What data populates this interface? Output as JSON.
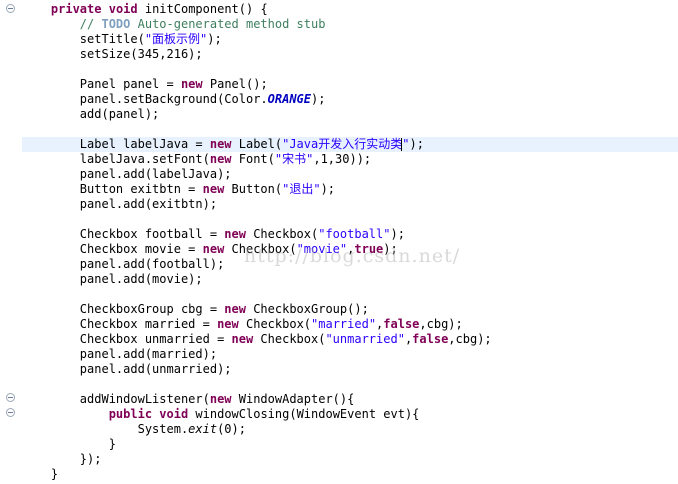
{
  "editor": {
    "lines": [
      "    private void initComponent() {",
      "        // TODO Auto-generated method stub",
      "        setTitle(\"面板示例\");",
      "        setSize(345,216);",
      "",
      "        Panel panel = new Panel();",
      "        panel.setBackground(Color.ORANGE);",
      "        add(panel);",
      "",
      "        Label labelJava = new Label(\"Java开发入行实动类\");",
      "        labelJava.setFont(new Font(\"宋书\",1,30));",
      "        panel.add(labelJava);",
      "        Button exitbtn = new Button(\"退出\");",
      "        panel.add(exitbtn);",
      "",
      "        Checkbox football = new Checkbox(\"football\");",
      "        Checkbox movie = new Checkbox(\"movie\",true);",
      "        panel.add(football);",
      "        panel.add(movie);",
      "",
      "        CheckboxGroup cbg = new CheckboxGroup();",
      "        Checkbox married = new Checkbox(\"married\",false,cbg);",
      "        Checkbox unmarried = new Checkbox(\"unmarried\",false,cbg);",
      "        panel.add(married);",
      "        panel.add(unmarried);",
      "",
      "        addWindowListener(new WindowAdapter(){",
      "            public void windowClosing(WindowEvent evt){",
      "                System.exit(0);",
      "            }",
      "        });",
      "    }"
    ],
    "current_line": 9,
    "watermark": "http://blog.csdn.net/"
  },
  "colors": {
    "keyword": "#7f0055",
    "string": "#2a00ff",
    "comment": "#3f7f5f",
    "todo": "#7f9fbf",
    "constant": "#0000c0",
    "current_line_bg": "#e8f2fe"
  },
  "gutter": {
    "fold_icon": "fold-collapse-icon"
  }
}
